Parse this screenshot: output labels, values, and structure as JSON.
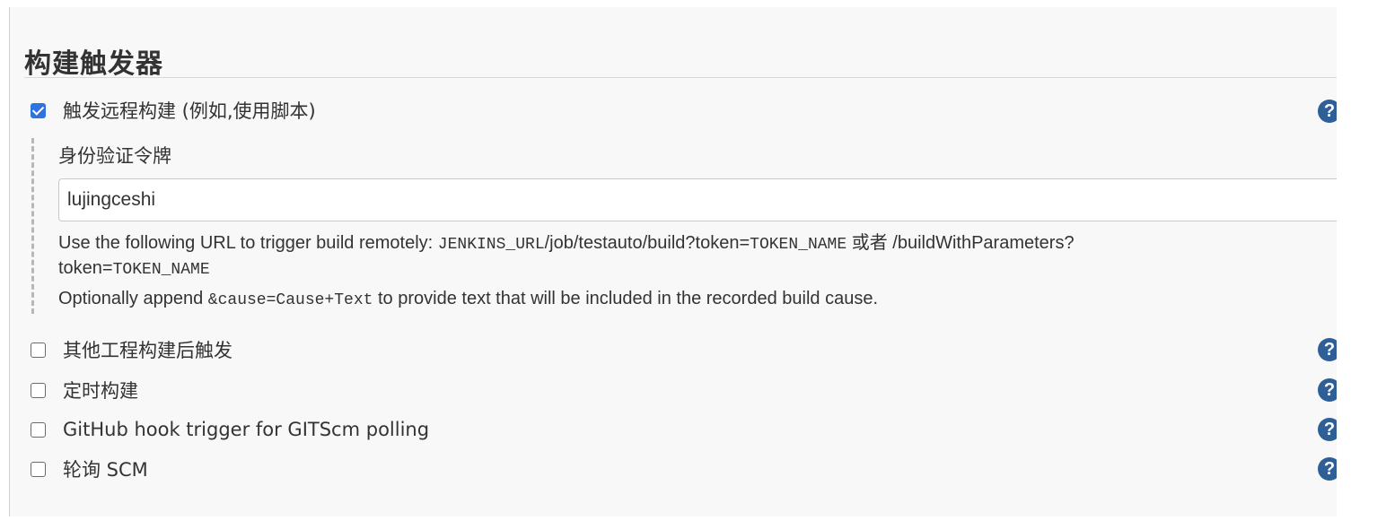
{
  "section": {
    "title": "构建触发器"
  },
  "triggers": [
    {
      "label": "触发远程构建 (例如,使用脚本)",
      "checked": true,
      "help": "?"
    },
    {
      "label": "其他工程构建后触发",
      "checked": false,
      "help": "?"
    },
    {
      "label": "定时构建",
      "checked": false,
      "help": "?"
    },
    {
      "label": "GitHub hook trigger for GITScm polling",
      "checked": false,
      "help": "?"
    },
    {
      "label": "轮询 SCM",
      "checked": false,
      "help": "?"
    }
  ],
  "remote": {
    "token_label": "身份验证令牌",
    "token_value": "lujingceshi",
    "desc_line1_prefix": "Use the following URL to trigger build remotely: ",
    "desc_line1_code1": "JENKINS_URL",
    "desc_line1_mid": "/job/testauto/build?token=",
    "desc_line1_code2": "TOKEN_NAME",
    "desc_line1_suffix": " 或者 /buildWithParameters?",
    "desc_line2_prefix": "token=",
    "desc_line2_code": "TOKEN_NAME",
    "desc_line3_prefix": "Optionally append ",
    "desc_line3_code": "&cause=Cause+Text",
    "desc_line3_suffix": " to provide text that will be included in the recorded build cause."
  },
  "colors": {
    "checkbox_checked": "#2f73e0",
    "help_icon": "#2e5f96",
    "panel_bg": "#f8f8f8"
  }
}
